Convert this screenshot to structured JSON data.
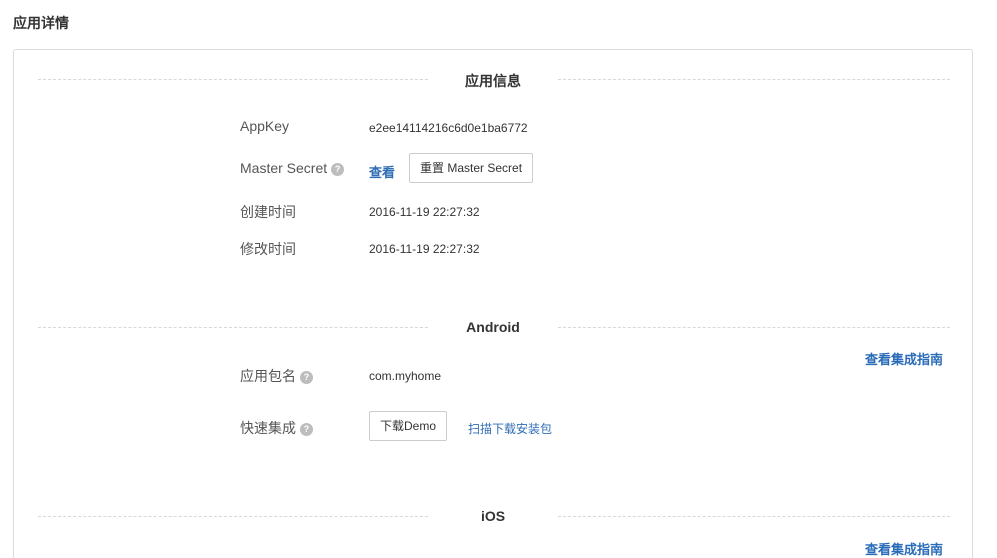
{
  "page": {
    "title": "应用详情"
  },
  "app_info": {
    "heading": "应用信息",
    "appkey_label": "AppKey",
    "appkey_value": "e2ee14114216c6d0e1ba6772",
    "master_secret_label": "Master Secret",
    "view_link": "查看",
    "reset_button": "重置 Master Secret",
    "created_label": "创建时间",
    "created_value": "2016-11-19 22:27:32",
    "modified_label": "修改时间",
    "modified_value": "2016-11-19 22:27:32"
  },
  "android": {
    "heading": "Android",
    "guide_link": "查看集成指南",
    "package_label": "应用包名",
    "package_value": "com.myhome",
    "quick_label": "快速集成",
    "download_button": "下载Demo",
    "scan_link": "扫描下载安装包"
  },
  "ios": {
    "heading": "iOS",
    "guide_link": "查看集成指南"
  },
  "help_glyph": "?",
  "colors": {
    "link": "#2f6db5",
    "border": "#dcdcdc",
    "dashed": "#d8d8d8"
  }
}
